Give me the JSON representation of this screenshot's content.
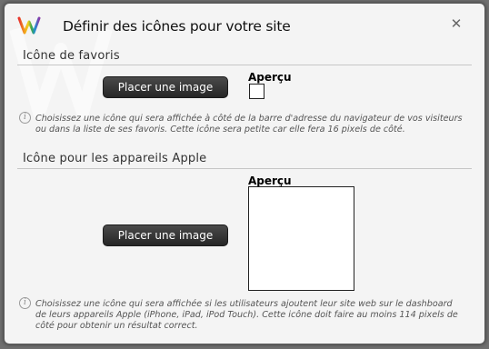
{
  "dialog": {
    "title": "Définir des icônes pour votre site",
    "close_glyph": "✕",
    "logo_icon": "w-logo-icon",
    "accent_colors": [
      "#e8322c",
      "#f29b1d",
      "#f3d11b",
      "#3aa64a",
      "#1e8fd6",
      "#8b3aa8"
    ]
  },
  "favicon": {
    "section_title": "Icône de favoris",
    "button_label": "Placer une image",
    "preview_label": "Aperçu",
    "info": "Choisissez une icône qui sera affichée à côté de la barre d'adresse du navigateur de vos visiteurs ou dans la liste de ses favoris. Cette icône sera petite car elle fera 16 pixels de côté."
  },
  "apple": {
    "section_title": "Icône pour les appareils Apple",
    "button_label": "Placer une image",
    "preview_label": "Aperçu",
    "info": "Choisissez une icône qui sera affichée si les utilisateurs ajoutent leur site web sur le dashboard de leurs appareils Apple (iPhone, iPad, iPod Touch). Cette icône doit faire au moins 114 pixels de côté pour obtenir un résultat correct."
  }
}
